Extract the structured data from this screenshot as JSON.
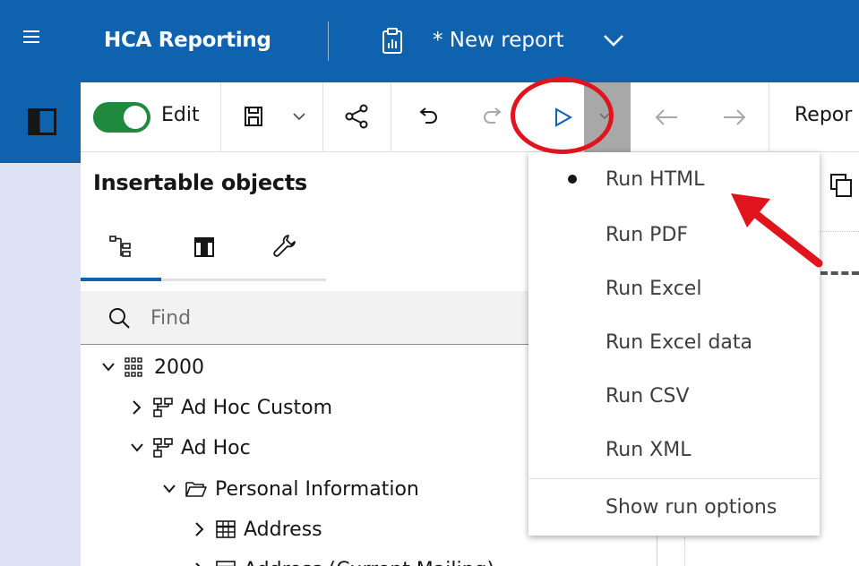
{
  "header": {
    "app_title": "HCA Reporting",
    "report_title": "* New report"
  },
  "toolbar": {
    "edit_label": "Edit",
    "edit_enabled": true,
    "report_tab_label": "Repor"
  },
  "panel": {
    "title": "Insertable objects",
    "tabs": [
      "source-tree",
      "toolbox",
      "tools"
    ],
    "search_placeholder": "Find"
  },
  "tree": [
    {
      "label": "2000",
      "expanded": true,
      "icon": "package-icon"
    },
    {
      "label": "Ad Hoc Custom",
      "expanded": false,
      "icon": "namespace-icon"
    },
    {
      "label": "Ad Hoc",
      "expanded": true,
      "icon": "namespace-icon"
    },
    {
      "label": "Personal Information",
      "expanded": true,
      "icon": "folder-icon"
    },
    {
      "label": "Address",
      "expanded": false,
      "icon": "table-icon"
    },
    {
      "label": "Address (Current Mailing)",
      "expanded": false,
      "icon": "table-icon"
    }
  ],
  "run_menu": {
    "items": [
      {
        "label": "Run HTML",
        "selected": true
      },
      {
        "label": "Run PDF",
        "selected": false
      },
      {
        "label": "Run Excel",
        "selected": false
      },
      {
        "label": "Run Excel data",
        "selected": false
      },
      {
        "label": "Run CSV",
        "selected": false
      },
      {
        "label": "Run XML",
        "selected": false
      }
    ],
    "options_label": "Show run options"
  },
  "colors": {
    "header_bg": "#0f62ae",
    "rail_bg": "#dde3f5",
    "toggle_on": "#1f8a3d",
    "annotation_red": "#e0141c"
  }
}
